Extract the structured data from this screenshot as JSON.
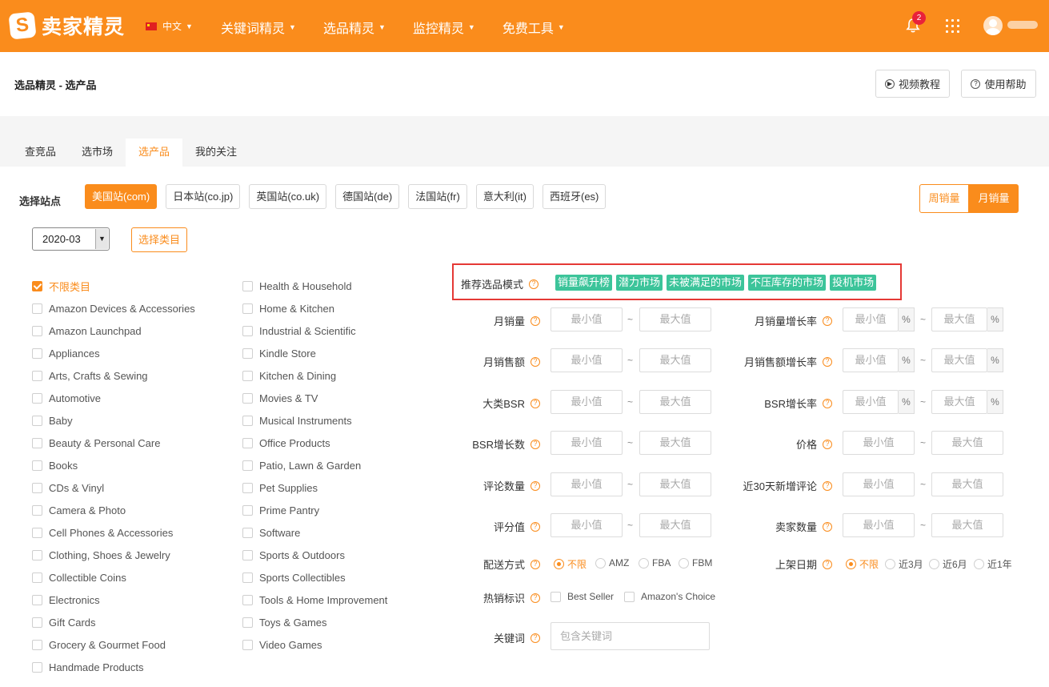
{
  "app": {
    "logo_text": "卖家精灵",
    "logo_mark": "S",
    "lang": "中文"
  },
  "nav": [
    "关键词精灵",
    "选品精灵",
    "监控精灵",
    "免费工具"
  ],
  "notifications": {
    "count": "2"
  },
  "breadcrumb": "选品精灵 - 选产品",
  "header_buttons": {
    "video": "视频教程",
    "help": "使用帮助"
  },
  "tabs": [
    "查竞品",
    "选市场",
    "选产品",
    "我的关注"
  ],
  "station": {
    "label": "选择站点",
    "items": [
      "美国站(com)",
      "日本站(co.jp)",
      "英国站(co.uk)",
      "德国站(de)",
      "法国站(fr)",
      "意大利(it)",
      "西班牙(es)"
    ]
  },
  "sales_toggle": {
    "weekly": "周销量",
    "monthly": "月销量"
  },
  "date_select": "2020-03",
  "category_button": "选择类目",
  "categories_left": [
    "不限类目",
    "Amazon Devices & Accessories",
    "Amazon Launchpad",
    "Appliances",
    "Arts, Crafts & Sewing",
    "Automotive",
    "Baby",
    "Beauty & Personal Care",
    "Books",
    "CDs & Vinyl",
    "Camera & Photo",
    "Cell Phones & Accessories",
    "Clothing, Shoes & Jewelry",
    "Collectible Coins",
    "Electronics",
    "Gift Cards",
    "Grocery & Gourmet Food",
    "Handmade Products"
  ],
  "categories_right": [
    "Health & Household",
    "Home & Kitchen",
    "Industrial & Scientific",
    "Kindle Store",
    "Kitchen & Dining",
    "Movies & TV",
    "Musical Instruments",
    "Office Products",
    "Patio, Lawn & Garden",
    "Pet Supplies",
    "Prime Pantry",
    "Software",
    "Sports & Outdoors",
    "Sports Collectibles",
    "Tools & Home Improvement",
    "Toys & Games",
    "Video Games"
  ],
  "recommend": {
    "label": "推荐选品模式",
    "tags": [
      "销量飙升榜",
      "潜力市场",
      "未被满足的市场",
      "不压库存的市场",
      "投机市场"
    ]
  },
  "placeholders": {
    "min": "最小值",
    "max": "最大值",
    "keyword": "包含关键词"
  },
  "symbols": {
    "tilde": "~",
    "percent": "%",
    "help": "?"
  },
  "filters_left": [
    "月销量",
    "月销售额",
    "大类BSR",
    "BSR增长数",
    "评论数量",
    "评分值"
  ],
  "filters_right": [
    "月销量增长率",
    "月销售额增长率",
    "BSR增长率",
    "价格",
    "近30天新增评论",
    "卖家数量"
  ],
  "shipping": {
    "label": "配送方式",
    "options": [
      "不限",
      "AMZ",
      "FBA",
      "FBM"
    ]
  },
  "listing_date": {
    "label": "上架日期",
    "options": [
      "不限",
      "近3月",
      "近6月",
      "近1年"
    ]
  },
  "hot_badge": {
    "label": "热销标识",
    "options": [
      "Best Seller",
      "Amazon's Choice"
    ]
  },
  "keyword": {
    "label": "关键词"
  }
}
